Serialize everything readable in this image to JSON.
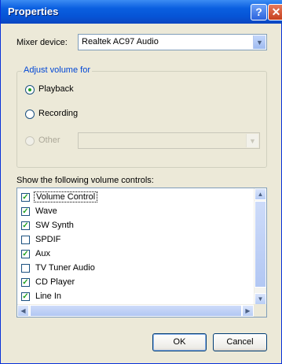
{
  "window": {
    "title": "Properties",
    "help_label": "?",
    "close_label": "✕"
  },
  "mixer": {
    "label": "Mixer device:",
    "mnemonic_index": 0,
    "value": "Realtek AC97 Audio"
  },
  "adjust": {
    "group_title": "Adjust volume for",
    "options": [
      {
        "label": "Playback",
        "selected": true,
        "disabled": false
      },
      {
        "label": "Recording",
        "selected": false,
        "disabled": false
      },
      {
        "label": "Other",
        "selected": false,
        "disabled": true
      }
    ],
    "other_value": ""
  },
  "controls": {
    "label": "Show the following volume controls:",
    "items": [
      {
        "label": "Volume Control",
        "checked": true,
        "focused": true
      },
      {
        "label": "Wave",
        "checked": true,
        "focused": false
      },
      {
        "label": "SW Synth",
        "checked": true,
        "focused": false
      },
      {
        "label": "SPDIF",
        "checked": false,
        "focused": false
      },
      {
        "label": "Aux",
        "checked": true,
        "focused": false
      },
      {
        "label": "TV Tuner Audio",
        "checked": false,
        "focused": false
      },
      {
        "label": "CD Player",
        "checked": true,
        "focused": false
      },
      {
        "label": "Line In",
        "checked": true,
        "focused": false
      }
    ]
  },
  "buttons": {
    "ok": "OK",
    "cancel": "Cancel"
  },
  "icons": {
    "dropdown": "chevron-down-icon",
    "check": "checkmark-icon",
    "scroll_up": "arrow-up-icon",
    "scroll_down": "arrow-down-icon",
    "scroll_left": "arrow-left-icon",
    "scroll_right": "arrow-right-icon"
  },
  "colors": {
    "title_bar": "#0a5fe0",
    "group_title": "#0046d5",
    "check": "#21a121",
    "face": "#ece9d8"
  }
}
